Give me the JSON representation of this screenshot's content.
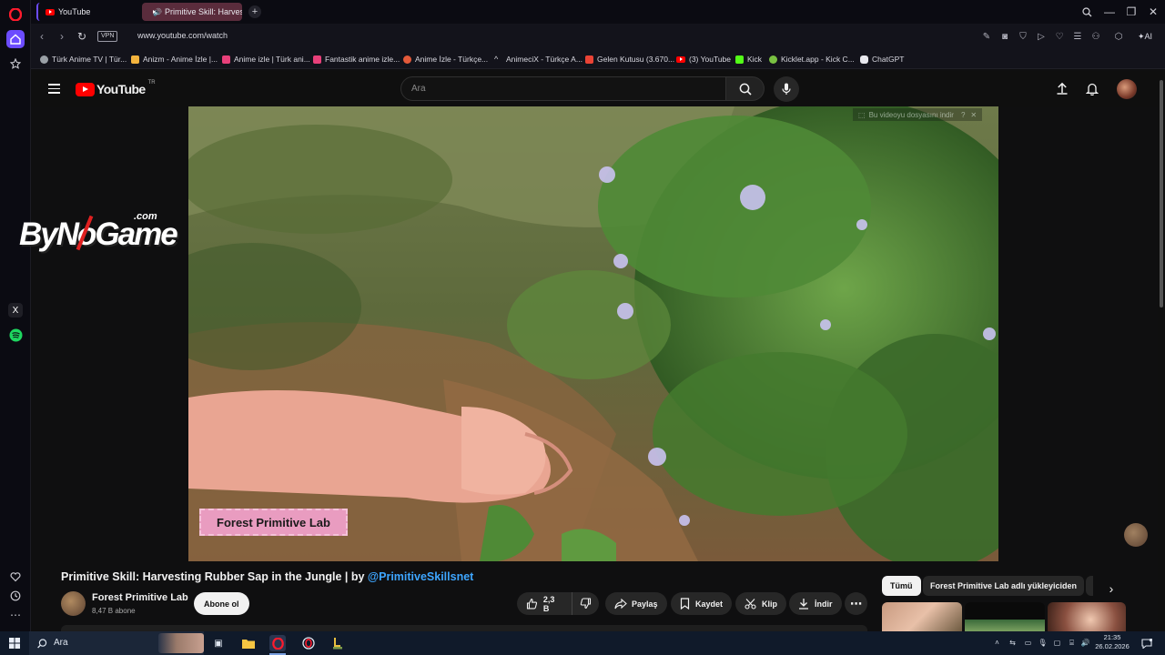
{
  "tabs": [
    {
      "title": "YouTube",
      "active": false
    },
    {
      "title": "Primitive Skill: Harvest",
      "active": true
    }
  ],
  "address": {
    "vpn": "VPN",
    "url": "www.youtube.com/watch",
    "ai": "AI"
  },
  "bookmarks": [
    {
      "label": "Türk Anime TV | Tür...",
      "color": "#9aa0a6"
    },
    {
      "label": "Anizm - Anime İzle |...",
      "color": "#f3b33d"
    },
    {
      "label": "Anime izle | Türk ani...",
      "color": "#e8407a"
    },
    {
      "label": "Fantastik anime izle...",
      "color": "#e8407a"
    },
    {
      "label": "Anime İzle - Türkçe...",
      "color": "#e45a3a"
    },
    {
      "label": "AnimeciX - Türkçe A...",
      "color": "#cfcfd6"
    },
    {
      "label": "Gelen Kutusu (3.670...",
      "color": "#ea4335"
    },
    {
      "label": "(3) YouTube",
      "color": "#ff0000"
    },
    {
      "label": "Kick",
      "color": "#53fc18"
    },
    {
      "label": "Kicklet.app - Kick C...",
      "color": "#7ac142"
    },
    {
      "label": "ChatGPT",
      "color": "#e8e8ee"
    }
  ],
  "youtube": {
    "logo_text": "YouTube",
    "region": "TR",
    "search_placeholder": "Ara"
  },
  "player": {
    "overlay_top": "Bu videoyu dosyasını indir",
    "watermark": "Forest Primitive Lab"
  },
  "side_logo": {
    "text": "ByNoGame",
    "suffix": ".com"
  },
  "video": {
    "title_main": "Primitive Skill: Harvesting Rubber Sap in the Jungle | by ",
    "title_handle": "@PrimitiveSkillsnet",
    "channel_name": "Forest Primitive Lab",
    "subscribers": "8,47 B abone",
    "subscribe_label": "Abone ol",
    "likes": "2,3 B",
    "share_label": "Paylaş",
    "save_label": "Kaydet",
    "clip_label": "Klip",
    "download_label": "İndir"
  },
  "chips": [
    "Tümü",
    "Forest Primitive Lab adlı yükleyiciden"
  ],
  "taskbar": {
    "search_placeholder": "Ara",
    "time": "21:35",
    "date": "26.02.2026"
  },
  "colors": {
    "accent_link": "#3ea6ff",
    "yt_red": "#ff0000",
    "opera_red": "#ff1b2d"
  }
}
